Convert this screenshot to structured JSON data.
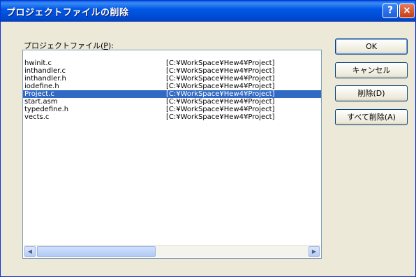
{
  "window": {
    "title": "プロジェクトファイルの削除",
    "help_label": "?",
    "close_label": "×"
  },
  "list": {
    "label": "プロジェクトファイル(",
    "label_key": "P",
    "label_suffix": "):",
    "rows": [
      {
        "name": "hwinit.c",
        "path": "[C:¥WorkSpace¥Hew4¥Project]"
      },
      {
        "name": "inthandler.c",
        "path": "[C:¥WorkSpace¥Hew4¥Project]"
      },
      {
        "name": "inthandler.h",
        "path": "[C:¥WorkSpace¥Hew4¥Project]"
      },
      {
        "name": "iodefine.h",
        "path": "[C:¥WorkSpace¥Hew4¥Project]"
      },
      {
        "name": "Project.c",
        "path": "[C:¥WorkSpace¥Hew4¥Project]",
        "selected": true
      },
      {
        "name": "start.asm",
        "path": "[C:¥WorkSpace¥Hew4¥Project]"
      },
      {
        "name": "typedefine.h",
        "path": "[C:¥WorkSpace¥Hew4¥Project]"
      },
      {
        "name": "vects.c",
        "path": "[C:¥WorkSpace¥Hew4¥Project]"
      }
    ]
  },
  "scrollbar": {
    "left_arrow": "◀",
    "right_arrow": "▶"
  },
  "buttons": {
    "ok": "OK",
    "cancel": "キャンセル",
    "delete": "削除(D)",
    "delete_all": "すべて削除(A)"
  },
  "colors": {
    "titlebar": "#0054e3",
    "selection": "#316ac5",
    "dialog_bg": "#ece9d8"
  }
}
